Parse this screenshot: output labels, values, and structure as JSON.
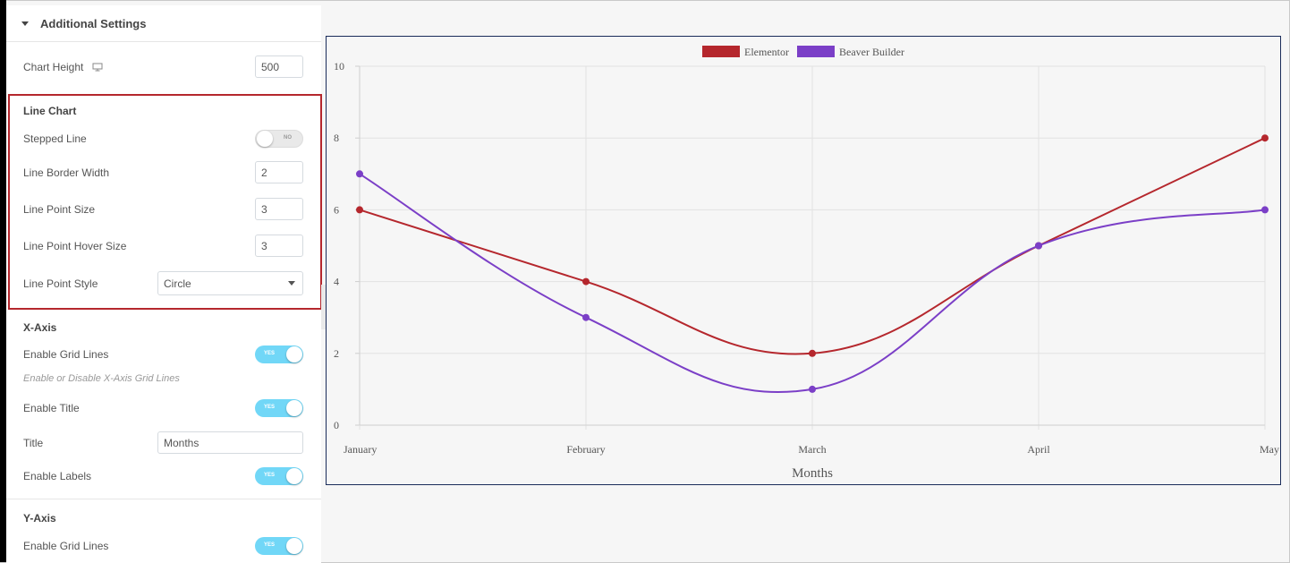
{
  "panel": {
    "header_title": "Additional Settings",
    "chart_height": {
      "label": "Chart Height",
      "value": "500"
    },
    "line_chart": {
      "title": "Line Chart",
      "stepped_line": {
        "label": "Stepped Line",
        "toggle_text": "NO"
      },
      "border_width": {
        "label": "Line Border Width",
        "value": "2"
      },
      "point_size": {
        "label": "Line Point Size",
        "value": "3"
      },
      "point_hover_size": {
        "label": "Line Point Hover Size",
        "value": "3"
      },
      "point_style": {
        "label": "Line Point Style",
        "value": "Circle"
      }
    },
    "x_axis": {
      "title": "X-Axis",
      "grid_lines": {
        "label": "Enable Grid Lines",
        "toggle_text": "YES"
      },
      "grid_hint": "Enable or Disable X-Axis Grid Lines",
      "enable_title": {
        "label": "Enable Title",
        "toggle_text": "YES"
      },
      "title_field": {
        "label": "Title",
        "value": "Months"
      },
      "labels": {
        "label": "Enable Labels",
        "toggle_text": "YES"
      }
    },
    "y_axis": {
      "title": "Y-Axis",
      "grid_lines": {
        "label": "Enable Grid Lines",
        "toggle_text": "YES"
      }
    }
  },
  "colors": {
    "series_1": "#b5272d",
    "series_2": "#7b3fc7",
    "highlight": "#b5272d",
    "toggle_on": "#71d7f7"
  },
  "chart_data": {
    "type": "line",
    "categories": [
      "January",
      "February",
      "March",
      "April",
      "May"
    ],
    "series": [
      {
        "name": "Elementor",
        "values": [
          6,
          4,
          2,
          5,
          8
        ]
      },
      {
        "name": "Beaver Builder",
        "values": [
          7,
          3,
          1,
          5,
          6
        ]
      }
    ],
    "xlabel": "Months",
    "ylabel": "",
    "ylim": [
      0,
      10
    ],
    "yticks": [
      0,
      2,
      4,
      6,
      8,
      10
    ],
    "grid": true,
    "legend": "top-center"
  }
}
